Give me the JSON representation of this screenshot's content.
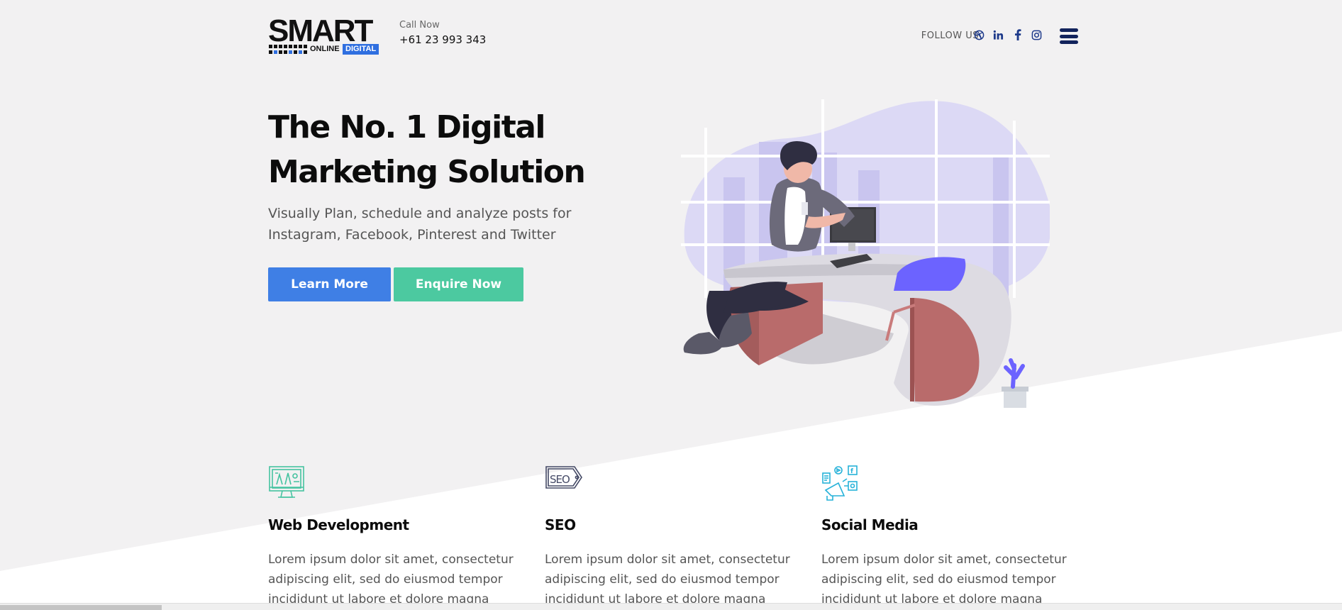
{
  "header": {
    "logo_word": "SMART",
    "logo_online": "ONLINE",
    "logo_digital": "DIGITAL",
    "call_label": "Call Now",
    "phone": "+61 23 993 343",
    "follow_label": "FOLLOW US",
    "social_icons": [
      "dribbble-icon",
      "linkedin-icon",
      "facebook-icon",
      "instagram-icon"
    ]
  },
  "hero": {
    "title_line1": "The No. 1 Digital",
    "title_line2": "Marketing Solution",
    "subtitle": "Visually Plan, schedule and analyze posts for Instagram, Facebook, Pinterest and Twitter",
    "learn_more": "Learn More",
    "enquire_now": "Enquire Now"
  },
  "services": [
    {
      "title": "Web Development",
      "text": "Lorem ipsum dolor sit amet, consectetur adipiscing elit, sed do eiusmod tempor incididunt ut labore et dolore magna",
      "icon": "monitor-design-icon"
    },
    {
      "title": "SEO",
      "text": "Lorem ipsum dolor sit amet, consectetur adipiscing elit, sed do eiusmod tempor incididunt ut labore et dolore magna",
      "icon": "seo-tag-icon"
    },
    {
      "title": "Social Media",
      "text": "Lorem ipsum dolor sit amet, consectetur adipiscing elit, sed do eiusmod tempor incididunt ut labore et dolore magna",
      "icon": "social-megaphone-icon"
    }
  ],
  "colors": {
    "background": "#f2f1f2",
    "learn_button": "#3f7fe5",
    "enquire_button": "#4cc9a0",
    "social_icon": "#1e3a8a",
    "menu_icon": "#12235c",
    "illustration_accent": "#6c63ff",
    "desk_red": "#b96b6b"
  }
}
